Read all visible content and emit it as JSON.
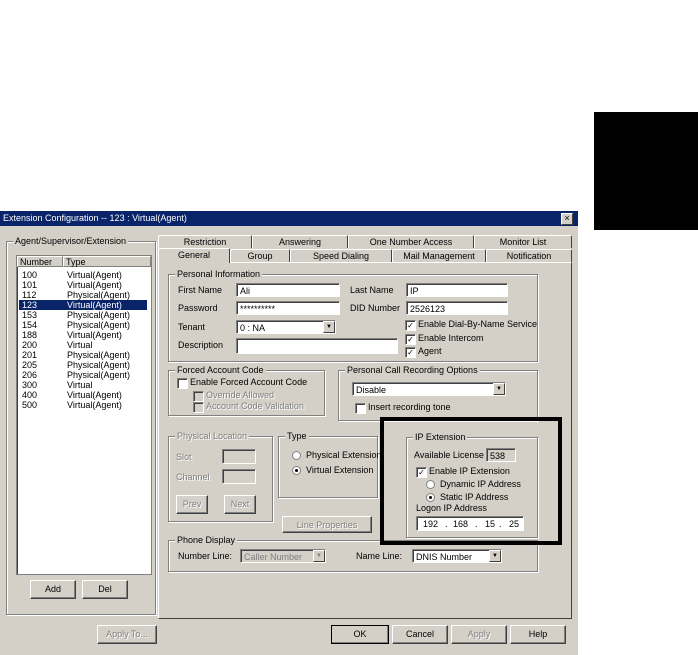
{
  "window": {
    "title": "Extension Configuration -- 123 : Virtual(Agent)",
    "close": "×"
  },
  "left_panel": {
    "group_label": "Agent/Supervisor/Extension",
    "columns": [
      "Number",
      "Type"
    ],
    "rows": [
      {
        "number": "100",
        "type": "Virtual(Agent)"
      },
      {
        "number": "101",
        "type": "Virtual(Agent)"
      },
      {
        "number": "112",
        "type": "Physical(Agent)"
      },
      {
        "number": "123",
        "type": "Virtual(Agent)",
        "selected": true
      },
      {
        "number": "153",
        "type": "Physical(Agent)"
      },
      {
        "number": "154",
        "type": "Physical(Agent)"
      },
      {
        "number": "188",
        "type": "Virtual(Agent)"
      },
      {
        "number": "200",
        "type": "Virtual"
      },
      {
        "number": "201",
        "type": "Physical(Agent)"
      },
      {
        "number": "205",
        "type": "Physical(Agent)"
      },
      {
        "number": "206",
        "type": "Physical(Agent)"
      },
      {
        "number": "300",
        "type": "Virtual"
      },
      {
        "number": "400",
        "type": "Virtual(Agent)"
      },
      {
        "number": "500",
        "type": "Virtual(Agent)"
      }
    ],
    "add": "Add",
    "del": "Del"
  },
  "tabs_back": [
    "Restriction",
    "Answering",
    "One Number Access",
    "Monitor List"
  ],
  "tabs_front": [
    "General",
    "Group",
    "Speed Dialing",
    "Mail Management",
    "Notification"
  ],
  "personal": {
    "label": "Personal Information",
    "first_name_label": "First Name",
    "first_name": "Ali",
    "last_name_label": "Last Name",
    "last_name": "IP",
    "password_label": "Password",
    "password": "**********",
    "did_label": "DID Number",
    "did": "2526123",
    "tenant_label": "Tenant",
    "tenant": "0 : NA",
    "description_label": "Description",
    "description": "",
    "dial_by_name": "Enable Dial-By-Name Service",
    "intercom": "Enable Intercom",
    "agent": "Agent",
    "check_mark": "✓"
  },
  "forced": {
    "label": "Forced Account Code",
    "enable": "Enable Forced Account Code",
    "override": "Override Allowed",
    "validation": "Account Code Validation"
  },
  "recording": {
    "label": "Personal Call Recording Options",
    "value": "Disable",
    "insert_tone": "Insert recording tone"
  },
  "physical": {
    "label": "Physical Location",
    "slot": "Slot",
    "channel": "Channel",
    "prev": "Prev",
    "next": "Next"
  },
  "type": {
    "label": "Type",
    "physical": "Physical Extension",
    "virtual": "Virtual Extension"
  },
  "line_properties": "Line Properties",
  "ip": {
    "label": "IP Extension",
    "available_label": "Available License",
    "available": "538",
    "enable": "Enable IP Extension",
    "dynamic": "Dynamic IP Address",
    "static": "Static IP Address",
    "logon_label": "Logon IP Address",
    "octets": [
      "192",
      "168",
      "15",
      "25"
    ],
    "dot": "."
  },
  "phone_display": {
    "label": "Phone Display",
    "number_line_label": "Number Line:",
    "number_line": "Caller Number",
    "name_line_label": "Name Line:",
    "name_line": "DNIS Number"
  },
  "footer": {
    "apply_to": "Apply To...",
    "ok": "OK",
    "cancel": "Cancel",
    "apply": "Apply",
    "help": "Help"
  },
  "arrow": "▼",
  "colors": {
    "titlebar": "#0a246a",
    "face": "#d4d0c8",
    "highlight_box": "#000000"
  }
}
